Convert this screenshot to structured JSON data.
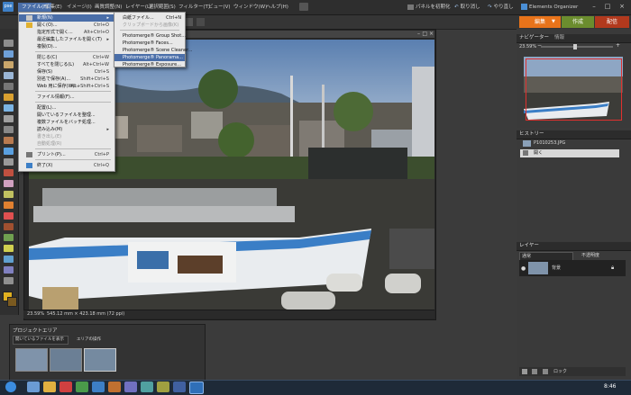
{
  "app": {
    "logo": "pse"
  },
  "menubar": {
    "items": [
      "ファイル(F)",
      "編集(E)",
      "イメージ(I)",
      "画質調整(N)",
      "レイヤー(L)",
      "選択範囲(S)",
      "フィルター(T)",
      "ビュー(V)",
      "ウィンドウ(W)",
      "ヘルプ(H)"
    ],
    "right_buttons": [
      "パネルを初期化",
      "取り消し",
      "やり直し",
      "Elements Organizer"
    ]
  },
  "mode_tabs": {
    "edit": "編集",
    "create": "作成",
    "share": "配信"
  },
  "file_menu": {
    "items": [
      {
        "label": "新規(N)",
        "shortcut": "",
        "state": "highlight",
        "arrow": true
      },
      {
        "label": "開く(O)...",
        "shortcut": "Ctrl+O",
        "state": "normal"
      },
      {
        "label": "指定形式で開く...",
        "shortcut": "Alt+Ctrl+O",
        "state": "normal"
      },
      {
        "label": "最近編集したファイルを開く(T)",
        "shortcut": "",
        "state": "normal",
        "arrow": true
      },
      {
        "label": "複製(D)...",
        "shortcut": "",
        "state": "normal"
      },
      {
        "label": "閉じる(C)",
        "shortcut": "Ctrl+W",
        "state": "normal"
      },
      {
        "label": "すべてを閉じる(L)",
        "shortcut": "Alt+Ctrl+W",
        "state": "normal"
      },
      {
        "label": "保存(S)",
        "shortcut": "Ctrl+S",
        "state": "normal"
      },
      {
        "label": "別名で保存(A)...",
        "shortcut": "Shift+Ctrl+S",
        "state": "normal"
      },
      {
        "label": "Web 用に保存(W)...",
        "shortcut": "Alt+Shift+Ctrl+S",
        "state": "normal"
      },
      {
        "label": "ファイル情報(F)...",
        "shortcut": "",
        "state": "normal"
      },
      {
        "label": "配置(L)...",
        "shortcut": "",
        "state": "normal"
      },
      {
        "label": "開いているファイルを整理...",
        "shortcut": "",
        "state": "normal"
      },
      {
        "label": "複数ファイルをバッチ処理...",
        "shortcut": "",
        "state": "normal"
      },
      {
        "label": "読み込み(M)",
        "shortcut": "",
        "state": "normal",
        "arrow": true
      },
      {
        "label": "書き出し(E)",
        "shortcut": "",
        "state": "disabled"
      },
      {
        "label": "自動処理(R)",
        "shortcut": "",
        "state": "disabled"
      },
      {
        "label": "プリント(P)...",
        "shortcut": "Ctrl+P",
        "state": "normal"
      },
      {
        "label": "終了(X)",
        "shortcut": "Ctrl+Q",
        "state": "normal"
      }
    ]
  },
  "new_menu": {
    "items": [
      {
        "label": "白紙ファイル...",
        "shortcut": "Ctrl+N",
        "state": "normal"
      },
      {
        "label": "クリップボードから画像(K)",
        "shortcut": "",
        "state": "disabled"
      },
      {
        "label": "Photomerge® Group Shot...",
        "shortcut": "",
        "state": "normal"
      },
      {
        "label": "Photomerge® Faces...",
        "shortcut": "",
        "state": "normal"
      },
      {
        "label": "Photomerge® Scene Cleaner...",
        "shortcut": "",
        "state": "normal"
      },
      {
        "label": "Photomerge® Panorama...",
        "shortcut": "",
        "state": "highlight"
      },
      {
        "label": "Photomerge® Exposure...",
        "shortcut": "",
        "state": "normal"
      }
    ]
  },
  "document": {
    "zoom": "23.59%",
    "status": "545.12 mm × 423.18 mm (72 ppi)"
  },
  "navigator": {
    "title": "ナビゲーター",
    "secondary_tab": "情報",
    "zoom": "23.59%"
  },
  "history": {
    "title": "ヒストリー",
    "file_name": "P1010253.JPG",
    "step": "開く"
  },
  "layers": {
    "title": "レイヤー",
    "blend_mode": "通常",
    "opacity_label": "不透明度",
    "layer_name": "背景",
    "lock_label": "ロック"
  },
  "project_bin": {
    "title": "プロジェクトエリア",
    "dropdown": "開いているファイルを表示",
    "action": "エリアの操作"
  },
  "taskbar": {
    "time": "8:46"
  },
  "colors": {
    "accent_edit": "#e8731a",
    "accent_create": "#6b8d2e",
    "accent_share": "#b2391d",
    "menu_highlight": "#4a6ea8"
  }
}
